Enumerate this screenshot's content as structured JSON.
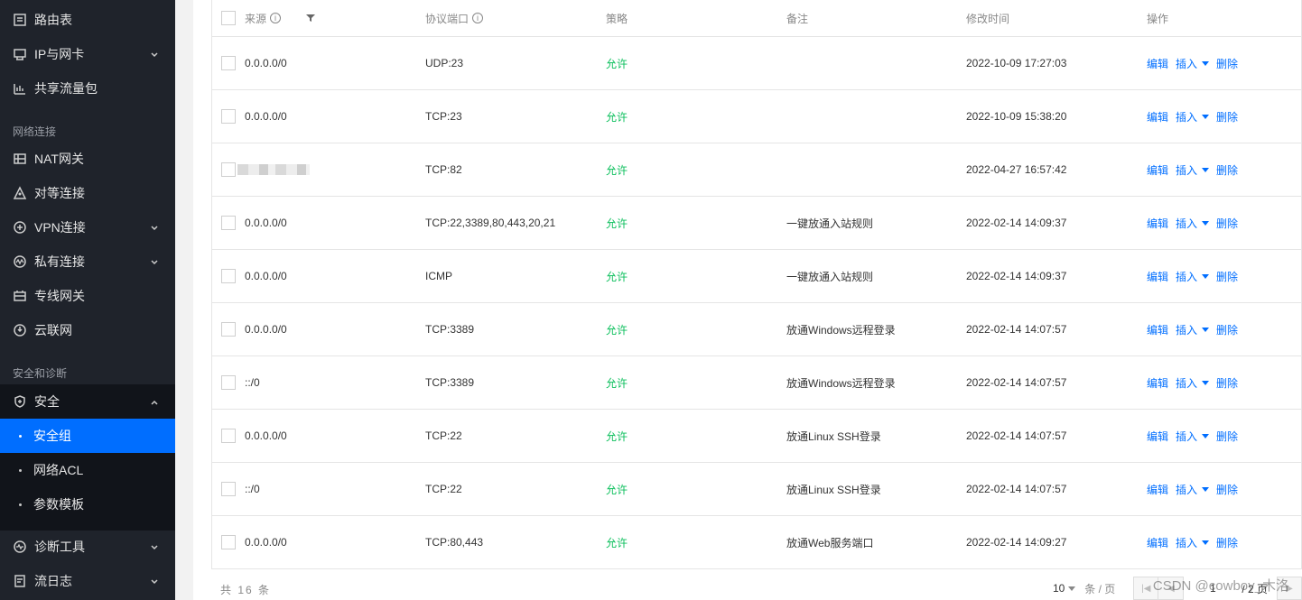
{
  "sidebar": {
    "top_items": [
      {
        "label": "路由表",
        "icon": "route-table-icon",
        "expandable": false
      },
      {
        "label": "IP与网卡",
        "icon": "network-card-icon",
        "expandable": true
      },
      {
        "label": "共享流量包",
        "icon": "traffic-package-icon",
        "expandable": false
      }
    ],
    "section_network": "网络连接",
    "network_items": [
      {
        "label": "NAT网关",
        "icon": "nat-gateway-icon",
        "expandable": false
      },
      {
        "label": "对等连接",
        "icon": "peering-icon",
        "expandable": false
      },
      {
        "label": "VPN连接",
        "icon": "vpn-icon",
        "expandable": true
      },
      {
        "label": "私有连接",
        "icon": "private-link-icon",
        "expandable": true
      },
      {
        "label": "专线网关",
        "icon": "dc-gateway-icon",
        "expandable": false
      },
      {
        "label": "云联网",
        "icon": "ccn-icon",
        "expandable": false
      }
    ],
    "section_security": "安全和诊断",
    "security_item": {
      "label": "安全",
      "icon": "shield-icon",
      "expanded": true
    },
    "security_sub": [
      {
        "label": "安全组",
        "active": true
      },
      {
        "label": "网络ACL",
        "active": false
      },
      {
        "label": "参数模板",
        "active": false
      }
    ],
    "bottom_items": [
      {
        "label": "诊断工具",
        "icon": "diagnose-icon",
        "expandable": true
      },
      {
        "label": "流日志",
        "icon": "flow-log-icon",
        "expandable": true
      }
    ]
  },
  "table": {
    "headers": {
      "source": "来源",
      "port": "协议端口",
      "policy": "策略",
      "note": "备注",
      "time": "修改时间",
      "ops": "操作"
    },
    "ops": {
      "edit": "编辑",
      "insert": "插入",
      "delete": "删除"
    },
    "rows": [
      {
        "source": "0.0.0.0/0",
        "port": "UDP:23",
        "policy": "允许",
        "note": "",
        "time": "2022-10-09 17:27:03",
        "blurred": false
      },
      {
        "source": "0.0.0.0/0",
        "port": "TCP:23",
        "policy": "允许",
        "note": "",
        "time": "2022-10-09 15:38:20",
        "blurred": false
      },
      {
        "source": "",
        "port": "TCP:82",
        "policy": "允许",
        "note": "",
        "time": "2022-04-27 16:57:42",
        "blurred": true
      },
      {
        "source": "0.0.0.0/0",
        "port": "TCP:22,3389,80,443,20,21",
        "policy": "允许",
        "note": "一键放通入站规则",
        "time": "2022-02-14 14:09:37",
        "blurred": false
      },
      {
        "source": "0.0.0.0/0",
        "port": "ICMP",
        "policy": "允许",
        "note": "一键放通入站规则",
        "time": "2022-02-14 14:09:37",
        "blurred": false
      },
      {
        "source": "0.0.0.0/0",
        "port": "TCP:3389",
        "policy": "允许",
        "note": "放通Windows远程登录",
        "time": "2022-02-14 14:07:57",
        "blurred": false
      },
      {
        "source": "::/0",
        "port": "TCP:3389",
        "policy": "允许",
        "note": "放通Windows远程登录",
        "time": "2022-02-14 14:07:57",
        "blurred": false
      },
      {
        "source": "0.0.0.0/0",
        "port": "TCP:22",
        "policy": "允许",
        "note": "放通Linux SSH登录",
        "time": "2022-02-14 14:07:57",
        "blurred": false
      },
      {
        "source": "::/0",
        "port": "TCP:22",
        "policy": "允许",
        "note": "放通Linux SSH登录",
        "time": "2022-02-14 14:07:57",
        "blurred": false
      },
      {
        "source": "0.0.0.0/0",
        "port": "TCP:80,443",
        "policy": "允许",
        "note": "放通Web服务端口",
        "time": "2022-02-14 14:09:27",
        "blurred": false
      }
    ]
  },
  "footer": {
    "total": "共 16 条",
    "page_size": "10",
    "page_size_unit": "条 / 页",
    "page_num": "1",
    "page_total": "/ 2 页"
  },
  "watermark": "CSDN @cowboy_木洛",
  "colors": {
    "active": "#006eff",
    "allow": "#0abf5b",
    "sidebar_bg": "#1f232b"
  }
}
